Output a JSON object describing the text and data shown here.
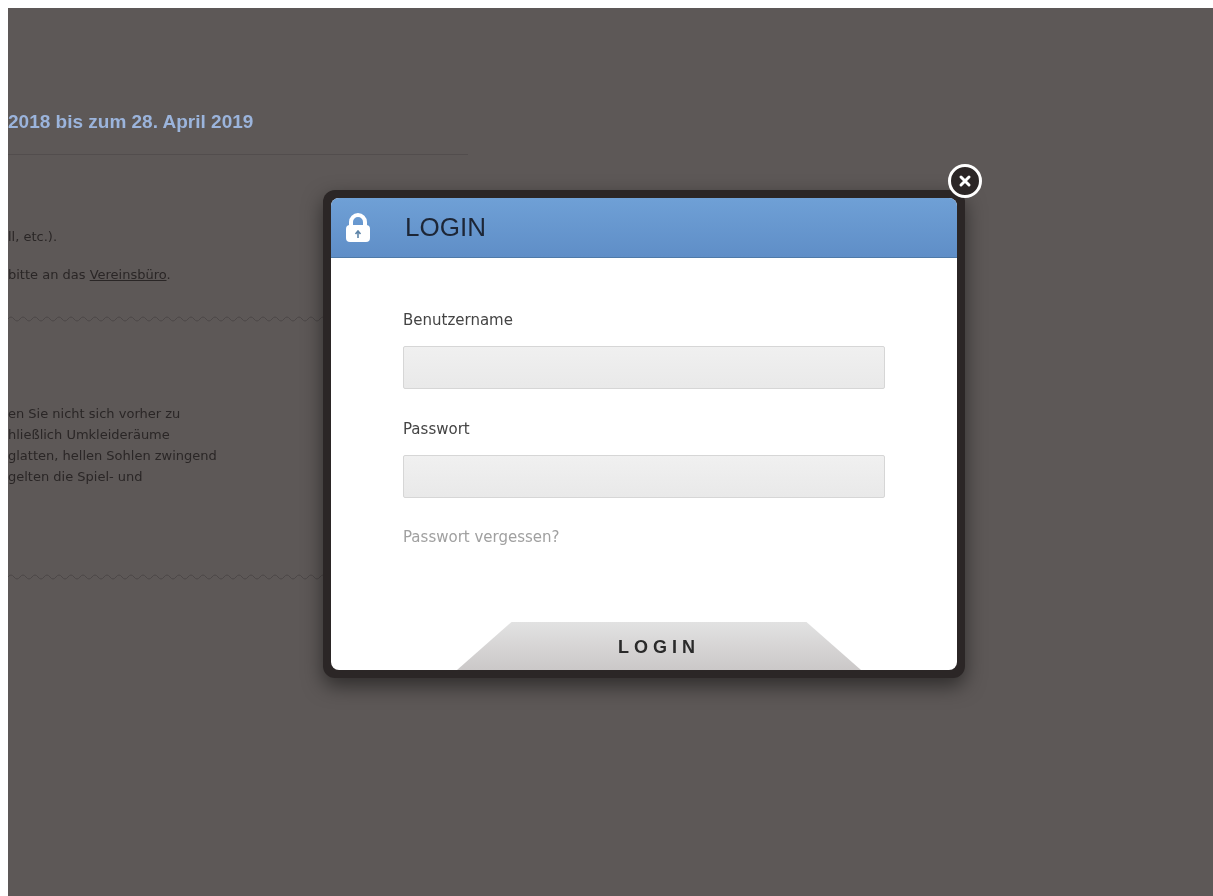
{
  "background_page": {
    "heading": "2018 bis zum 28. April 2019",
    "paragraphs": [
      {
        "text": "ll, etc.)."
      },
      {
        "text": "bitte an das ",
        "link": "Vereinsbüro",
        "after": "."
      }
    ],
    "notice_lines": [
      "en Sie nicht sich vorher zu",
      "hließlich Umkleideräume",
      "glatten, hellen Sohlen zwingend",
      "gelten die Spiel- und"
    ]
  },
  "login_dialog": {
    "title": "LOGIN",
    "fields": [
      {
        "label": "Benutzername"
      },
      {
        "label": "Passwort"
      }
    ],
    "forgot_link": "Passwort vergessen?",
    "submit_button": "LOGIN"
  }
}
